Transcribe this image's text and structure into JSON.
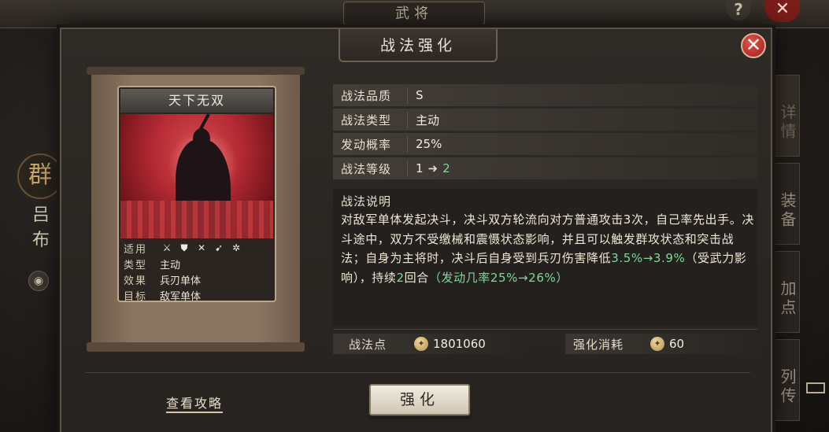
{
  "background": {
    "screen_title": "武将",
    "help_label": "?",
    "close_label": "✕",
    "faction": "群",
    "hero_name": "吕布",
    "side_tabs": [
      "详情",
      "装备",
      "加点",
      "列传"
    ]
  },
  "dialog": {
    "title": "战法强化",
    "close_label": "✕"
  },
  "card": {
    "name": "天下无双",
    "rows": [
      {
        "label": "适用",
        "value": ""
      },
      {
        "label": "类型",
        "value": "主动"
      },
      {
        "label": "效果",
        "value": "兵刃单体"
      },
      {
        "label": "目标",
        "value": "敌军单体"
      }
    ],
    "troop_icons": [
      "cavalry-axe-icon",
      "shield-icon",
      "bow-icon",
      "spear-icon",
      "wheel-icon"
    ]
  },
  "attributes": {
    "quality_label": "战法品质",
    "quality_value": "S",
    "type_label": "战法类型",
    "type_value": "主动",
    "rate_label": "发动概率",
    "rate_value": "25%",
    "level_label": "战法等级",
    "level_from": "1",
    "level_to": "2"
  },
  "description": {
    "title": "战法说明",
    "part1": "对敌军单体发起决斗，决斗双方轮流向对方普通攻击3次，自己率先出手。决斗途中，双方不受缴械和震慑状态影响，并且可以触发群攻状态和突击战法；自身为主将时，决斗后自身受到兵刃伤害降低",
    "hl1": "3.5%→3.9%",
    "part2": "（受武力影响），持续",
    "hl2": "2",
    "part3": "回合",
    "hl3": "（发动几率25%→26%）"
  },
  "costs": {
    "points_label": "战法点",
    "points_value": "1801060",
    "enhance_cost_label": "强化消耗",
    "enhance_cost_value": "60"
  },
  "footer": {
    "guide_link": "查看攻略",
    "enhance_button": "强化"
  },
  "colors": {
    "highlight_green": "#7fd79a",
    "close_red": "#c83a33"
  }
}
